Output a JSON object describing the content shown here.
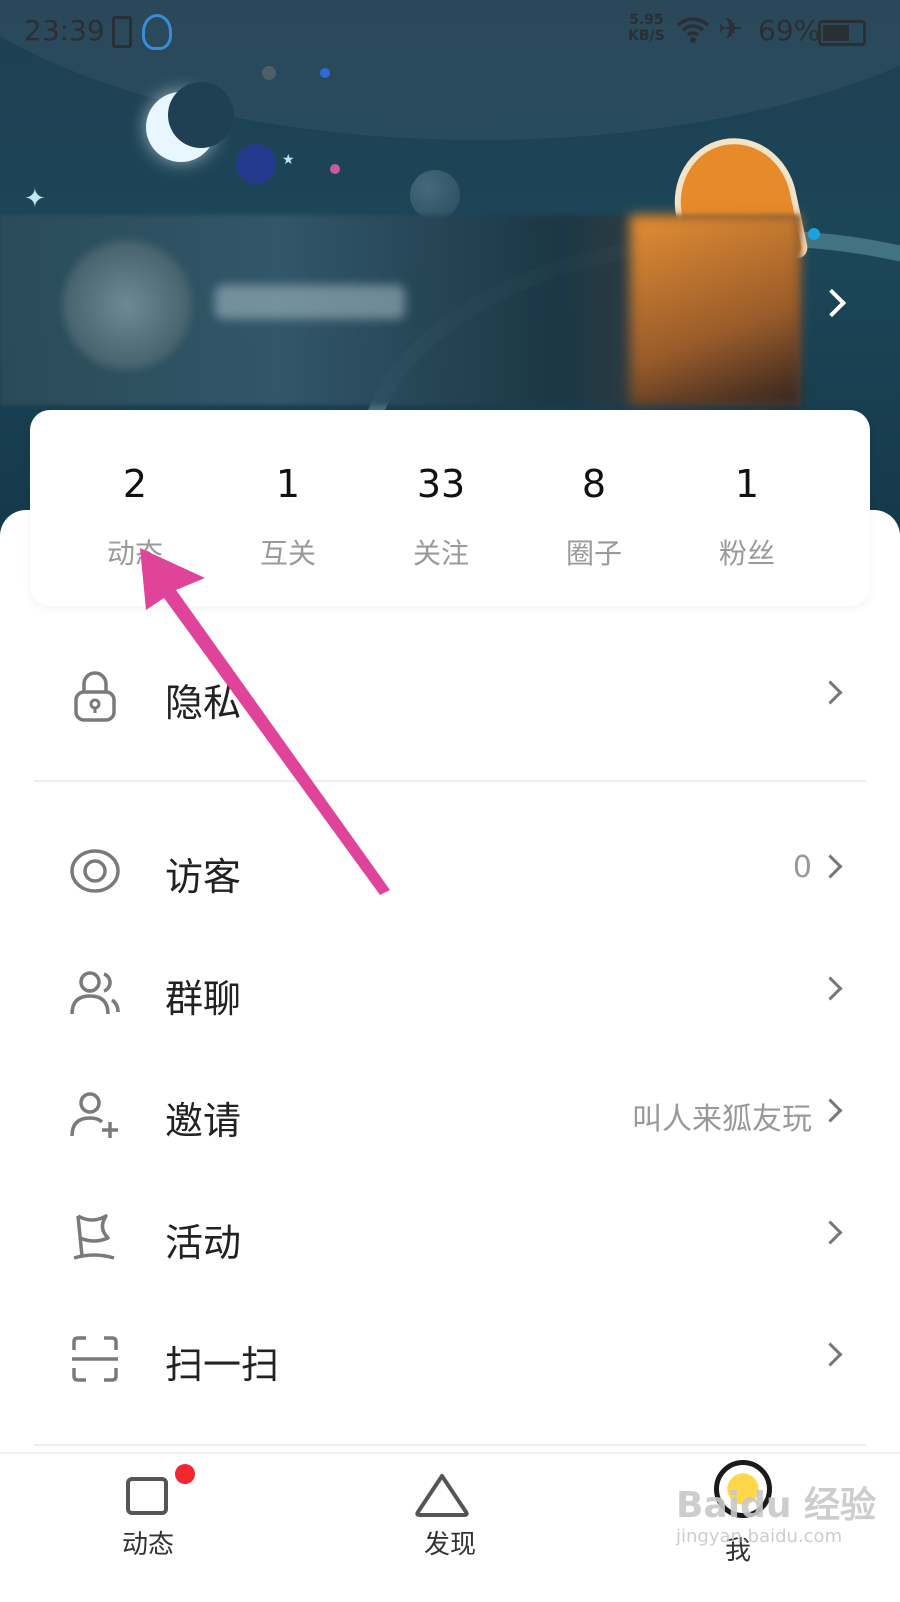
{
  "status_bar": {
    "time": "23:39",
    "speed_value": "5.95",
    "speed_unit": "KB/S",
    "battery": "69%",
    "battery_level": 0.69
  },
  "stats": [
    {
      "value": "2",
      "label": "动态"
    },
    {
      "value": "1",
      "label": "互关"
    },
    {
      "value": "33",
      "label": "关注"
    },
    {
      "value": "8",
      "label": "圈子"
    },
    {
      "value": "1",
      "label": "粉丝"
    }
  ],
  "menu": [
    {
      "icon": "lock-icon",
      "label": "隐私",
      "extra": ""
    },
    {
      "icon": "eye-icon",
      "label": "访客",
      "extra": "0"
    },
    {
      "icon": "group-icon",
      "label": "群聊",
      "extra": ""
    },
    {
      "icon": "add-user-icon",
      "label": "邀请",
      "extra": "叫人来狐友玩"
    },
    {
      "icon": "flag-icon",
      "label": "活动",
      "extra": ""
    },
    {
      "icon": "scan-icon",
      "label": "扫一扫",
      "extra": ""
    }
  ],
  "bottom_nav": [
    {
      "icon": "square-icon",
      "label": "动态",
      "badge": true
    },
    {
      "icon": "triangle-icon",
      "label": "发现",
      "badge": false
    },
    {
      "icon": "avatar-icon",
      "label": "我",
      "badge": false
    }
  ],
  "watermark": {
    "line1": "Baidu 经验",
    "line2": "jingyan.baidu.com"
  },
  "colors": {
    "accent": "#e0449a",
    "badge": "#f2272f",
    "header": "#1f3f52"
  }
}
